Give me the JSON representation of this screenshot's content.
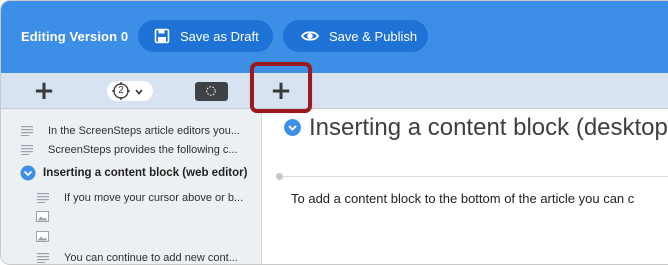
{
  "header": {
    "editing_label": "Editing Version 0",
    "save_draft_label": "Save as Draft",
    "save_publish_label": "Save & Publish"
  },
  "toolbar": {
    "add_label": "+",
    "target_number": "2",
    "add_block_label": "+"
  },
  "sidebar": {
    "items": [
      {
        "label": "In the ScreenSteps article editors you...",
        "icon": "text-lines-icon"
      },
      {
        "label": "ScreenSteps provides the following c...",
        "icon": "text-lines-icon"
      },
      {
        "label": "Inserting a content block (web editor)",
        "icon": "chevron-circle-icon"
      },
      {
        "label": "If you move your cursor above or b...",
        "icon": "text-lines-icon"
      },
      {
        "label": "",
        "icon": "image-icon"
      },
      {
        "label": "",
        "icon": "image-icon"
      },
      {
        "label": "You can continue to add new cont...",
        "icon": "text-lines-icon"
      }
    ]
  },
  "main": {
    "section_title": "Inserting a content block (desktop)",
    "body_text": "To add a content block to the bottom of the article you can c"
  },
  "colors": {
    "header_blue": "#3d8ee6",
    "pill_blue": "#1f73d6",
    "toolbar_bg": "#d7e3f1",
    "highlight_red": "#9c1a1f"
  }
}
